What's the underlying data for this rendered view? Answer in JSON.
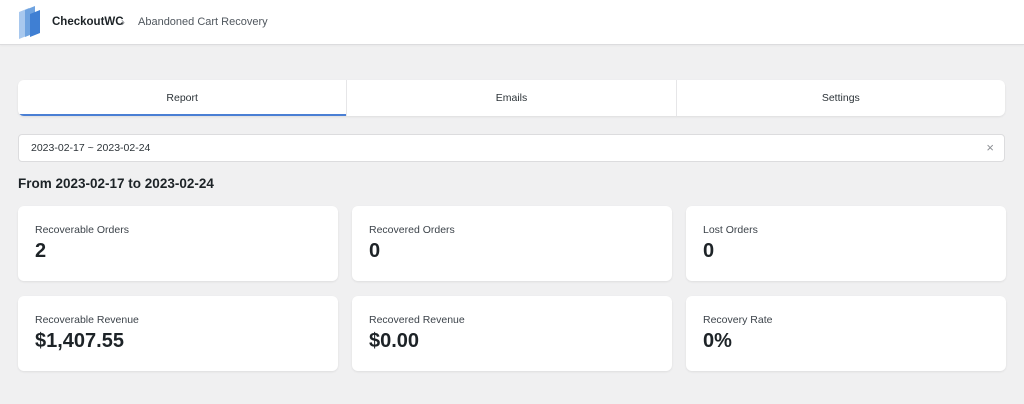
{
  "header": {
    "brand": "CheckoutWC",
    "breadcrumb_separator": "›",
    "breadcrumb": "Abandoned Cart Recovery"
  },
  "tabs": [
    {
      "label": "Report",
      "active": true
    },
    {
      "label": "Emails",
      "active": false
    },
    {
      "label": "Settings",
      "active": false
    }
  ],
  "date_range": {
    "value": "2023-02-17 ~ 2023-02-24",
    "clear_icon": "×",
    "heading": "From 2023-02-17 to 2023-02-24"
  },
  "stats": [
    {
      "label": "Recoverable Orders",
      "value": "2"
    },
    {
      "label": "Recovered Orders",
      "value": "0"
    },
    {
      "label": "Lost Orders",
      "value": "0"
    },
    {
      "label": "Recoverable Revenue",
      "value": "$1,407.55"
    },
    {
      "label": "Recovered Revenue",
      "value": "$0.00"
    },
    {
      "label": "Recovery Rate",
      "value": "0%"
    }
  ],
  "colors": {
    "accent": "#4a7fd4",
    "background": "#f0f0f1"
  }
}
